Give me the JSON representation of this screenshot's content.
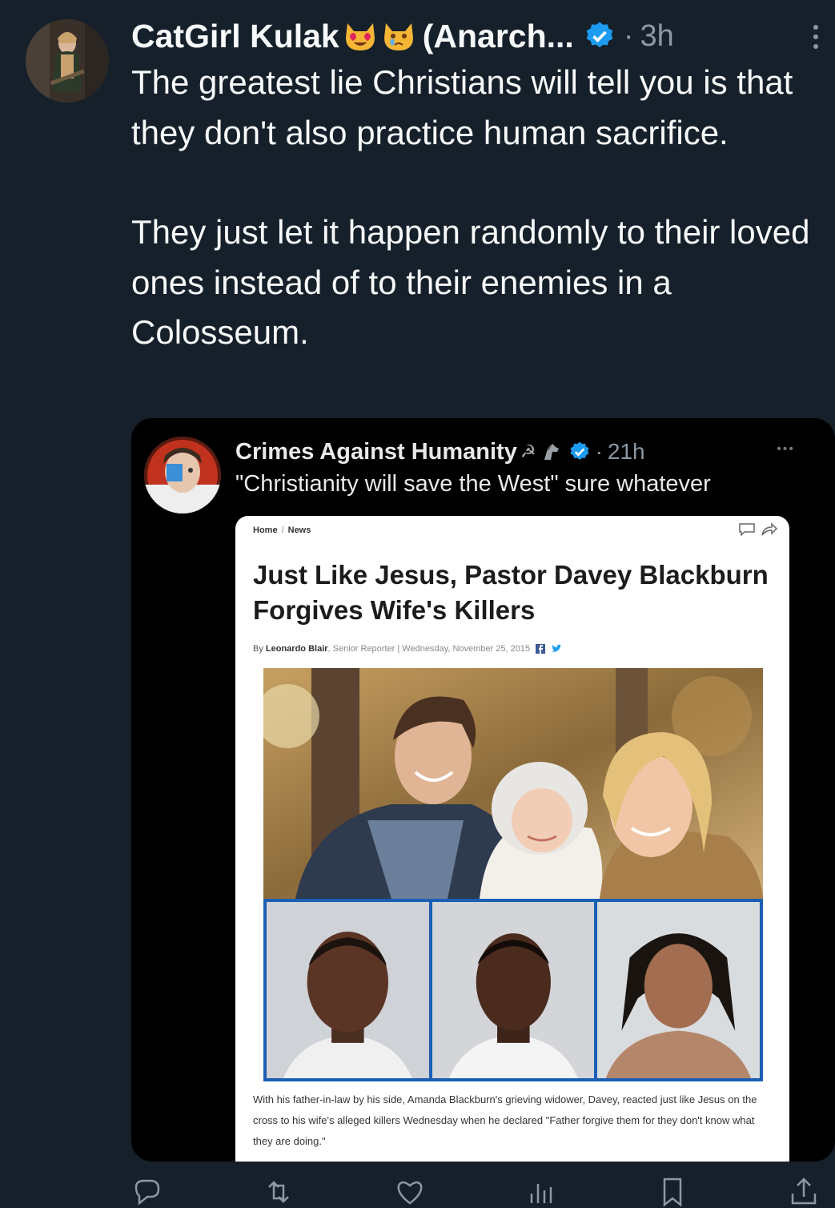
{
  "post": {
    "display_name": "CatGirl Kulak",
    "display_name_suffix": "(Anarch...",
    "time": "3h",
    "separator": "·",
    "paragraphs": [
      "The greatest lie Christians will tell you is that they don't also practice human sacrifice.",
      "They just let it happen randomly to their loved ones instead of to their enemies in a Colosseum."
    ]
  },
  "quoted_post": {
    "display_name": "Crimes Against Humanity",
    "time": "21h",
    "separator": "·",
    "more": "•••",
    "text": "\"Christianity will save the West\" sure whatever"
  },
  "article": {
    "breadcrumb": [
      "Home",
      "News"
    ],
    "headline": "Just Like Jesus, Pastor Davey Blackburn Forgives Wife's Killers",
    "byline_prefix": "By ",
    "author": "Leonardo Blair",
    "author_role": ", Senior Reporter",
    "byline_sep": " | ",
    "date": "Wednesday, November 25, 2015",
    "caption": "With his father-in-law by his side, Amanda Blackburn's grieving widower, Davey, reacted just like Jesus on the cross to his wife's alleged killers Wednesday when he declared \"Father forgive them for they don't know what they are doing.\""
  },
  "icons": {
    "verified": "verified-badge-icon",
    "more": "more-vertical-icon",
    "actions": [
      "reply-icon",
      "repost-icon",
      "like-icon",
      "views-icon",
      "bookmark-icon",
      "share-icon"
    ]
  },
  "colors": {
    "background": "#15202b",
    "text": "#f7f9f9",
    "muted": "#8b98a5",
    "verified": "#1d9bf0"
  }
}
